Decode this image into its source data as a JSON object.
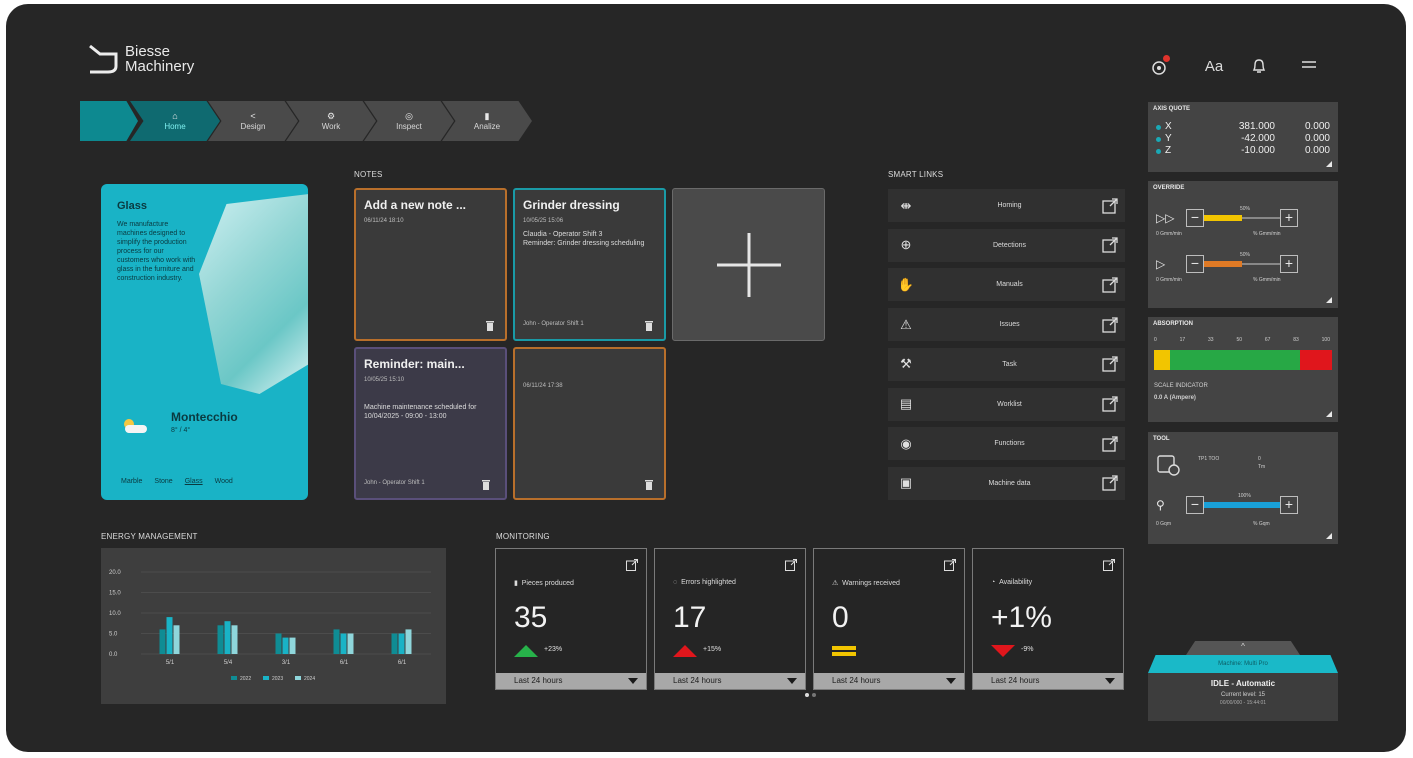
{
  "brand": {
    "name_line1": "Biesse",
    "name_line2": "Machinery"
  },
  "nav": [
    {
      "label": "Home",
      "icon": "home-icon"
    },
    {
      "label": "Design",
      "icon": "share-icon"
    },
    {
      "label": "Work",
      "icon": "gears-icon"
    },
    {
      "label": "Inspect",
      "icon": "target-icon"
    },
    {
      "label": "Analize",
      "icon": "bar-chart-icon"
    }
  ],
  "header_icons": [
    "network-alert-icon",
    "language-icon",
    "bell-icon",
    "menu-icon"
  ],
  "header": {
    "language": "Aa"
  },
  "glass_card": {
    "title": "Glass",
    "body": "We manufacture machines designed to simplify the production process for our customers who work with glass in the furniture and construction industry.",
    "city": "Montecchio",
    "temperature": "8° / 4°",
    "tabs": [
      "Marble",
      "Stone",
      "Glass",
      "Wood"
    ],
    "selected_tab": "Glass",
    "accent": "#19b3c6"
  },
  "notes": {
    "section_title": "NOTES",
    "items": [
      {
        "title": "Add a new note ...",
        "date": "06/11/24  18:10",
        "text": "",
        "footer": ""
      },
      {
        "title": "Grinder dressing",
        "date": "10/05/25  15:06",
        "text": "Claudia - Operator Shift 3\nReminder: Grinder dressing scheduling",
        "footer": "John - Operator Shift 1"
      },
      {
        "title": "Reminder: main...",
        "date": "10/05/25  15:10",
        "text": "Machine maintenance scheduled for 10/04/2025 - 09:00 - 13:00",
        "footer": "John - Operator Shift 1"
      },
      {
        "title": "",
        "date": "06/11/24  17:38",
        "text": "",
        "footer": ""
      }
    ]
  },
  "smart_links": {
    "section_title": "SMART LINKS",
    "items": [
      {
        "label": "Homing",
        "icon": "homing-icon"
      },
      {
        "label": "Detections",
        "icon": "detection-icon"
      },
      {
        "label": "Manuals",
        "icon": "hand-icon"
      },
      {
        "label": "Issues",
        "icon": "warning-icon"
      },
      {
        "label": "Task",
        "icon": "wrench-icon"
      },
      {
        "label": "Worklist",
        "icon": "list-icon"
      },
      {
        "label": "Functions",
        "icon": "functions-icon"
      },
      {
        "label": "Machine data",
        "icon": "machine-data-icon"
      }
    ]
  },
  "axis_quote": {
    "title": "AXIS QUOTE",
    "rows": [
      {
        "axis": "X",
        "v1": "381.000",
        "v2": "0.000"
      },
      {
        "axis": "Y",
        "v1": "-42.000",
        "v2": "0.000"
      },
      {
        "axis": "Z",
        "v1": "-10.000",
        "v2": "0.000"
      }
    ]
  },
  "override": {
    "title": "OVERRIDE",
    "rows": [
      {
        "pct_label": "50%",
        "fill_fraction": 0.5,
        "color": "#f2c500",
        "left": "0 Gmm/min",
        "right": "% Gmm/min"
      },
      {
        "pct_label": "50%",
        "fill_fraction": 0.5,
        "color": "#e07a25",
        "left": "0 Gmm/min",
        "right": "% Gmm/min"
      }
    ]
  },
  "absorption": {
    "title": "ABSORPTION",
    "ticks": [
      "0",
      "17",
      "33",
      "50",
      "67",
      "83",
      "100"
    ],
    "scale_label": "SCALE INDICATOR",
    "scale_value": "0.0 A (Ampere)"
  },
  "tool": {
    "title": "TOOL",
    "info1": "TP1 TOO",
    "info2": "0",
    "info3": "",
    "info4": "Tm",
    "pct_label": "100%",
    "fill_fraction": 1.0,
    "left": "0 Gqm",
    "right": "% Gqm"
  },
  "energy": {
    "title": "ENERGY MANAGEMENT",
    "y_ticks": [
      "20.0",
      "15.0",
      "10.0",
      "5.0",
      "0.0"
    ],
    "chart_data": {
      "type": "bar",
      "categories": [
        "5/1",
        "5/4",
        "3/1",
        "6/1",
        "6/1"
      ],
      "ylim": [
        0,
        20
      ],
      "series": [
        {
          "name": "2022",
          "color": "#0f8c94",
          "values": [
            6,
            7,
            5,
            6,
            5
          ]
        },
        {
          "name": "2023",
          "color": "#19b3c6",
          "values": [
            9,
            8,
            4,
            5,
            5
          ]
        },
        {
          "name": "2024",
          "color": "#8fd6db",
          "values": [
            7,
            7,
            4,
            5,
            6
          ]
        }
      ],
      "legend_position": "bottom"
    }
  },
  "monitoring": {
    "section_title": "MONITORING",
    "cards": [
      {
        "label": "Pieces produced",
        "icon": "bar-chart-icon",
        "value": "35",
        "delta": "+23%",
        "trend": "up",
        "period": "Last 24 hours"
      },
      {
        "label": "Errors highlighted",
        "icon": "error-icon",
        "value": "17",
        "delta": "+15%",
        "trend": "up-red",
        "period": "Last 24 hours"
      },
      {
        "label": "Warnings received",
        "icon": "warning-icon",
        "value": "0",
        "delta": "",
        "trend": "equal",
        "period": "Last 24 hours"
      },
      {
        "label": "Availability",
        "icon": "availability-icon",
        "value": "+1%",
        "delta": "-9%",
        "trend": "down",
        "period": "Last 24 hours"
      }
    ]
  },
  "status": {
    "band_text": "Machine: Multi Pro",
    "state": "IDLE - Automatic",
    "line2": "Current level: 15",
    "line3": "00/00/000 - 15:44:01"
  }
}
